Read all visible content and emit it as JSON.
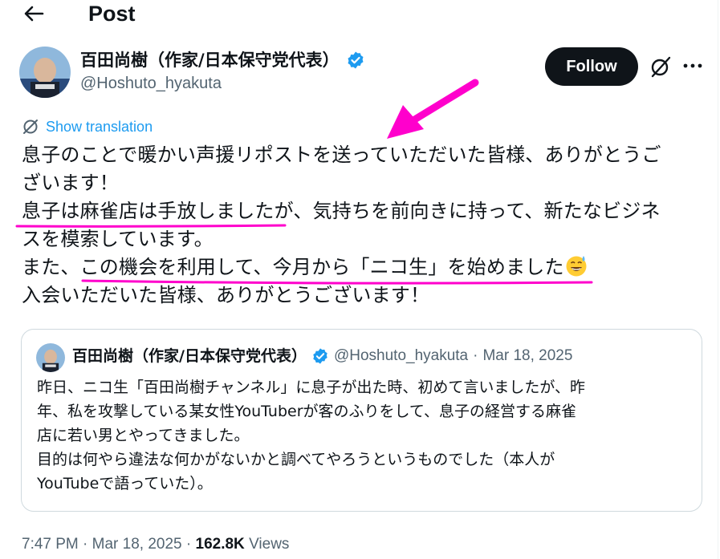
{
  "header": {
    "title": "Post",
    "back_icon": "arrow-left-icon"
  },
  "author": {
    "name": "百田尚樹（作家/日本保守党代表）",
    "handle": "@Hoshuto_hyakuta",
    "verified_icon": "verified-badge-icon",
    "verified_color": "#1d9bf0"
  },
  "actions": {
    "follow_label": "Follow",
    "grok_icon": "grok-icon",
    "more_icon": "more-dots-icon"
  },
  "translation": {
    "label": "Show translation",
    "icon": "translate-icon"
  },
  "post": {
    "lines": [
      "息子のことで暖かい声援リポストを送っていただいた皆様、ありがとうご",
      "ざいます！",
      "息子は麻雀店は手放しましたが、気持ちを前向きに持って、新たなビジネ",
      "スを模索しています。",
      "また、この機会を利用して、今月から「ニコ生」を始めました",
      "入会いただいた皆様、ありがとうございます！"
    ],
    "emoji": "grinning-sweat-emoji"
  },
  "annotations": {
    "color": "#ff00cc"
  },
  "quote": {
    "name": "百田尚樹（作家/日本保守党代表）",
    "handle": "@Hoshuto_hyakuta",
    "separator": "·",
    "date": "Mar 18, 2025",
    "lines": [
      "昨日、ニコ生「百田尚樹チャンネル」に息子が出た時、初めて言いましたが、昨",
      "年、私を攻撃している某女性YouTuberが客のふりをして、息子の経営する麻雀",
      "店に若い男とやってきました。",
      "目的は何やら違法な何かがないかと調べてやろうというものでした（本人が",
      "YouTubeで語っていた）。"
    ]
  },
  "meta": {
    "time": "7:47 PM",
    "separator": "·",
    "date": "Mar 18, 2025",
    "separator2": "·",
    "views_count": "162.8K",
    "views_label": "Views"
  }
}
